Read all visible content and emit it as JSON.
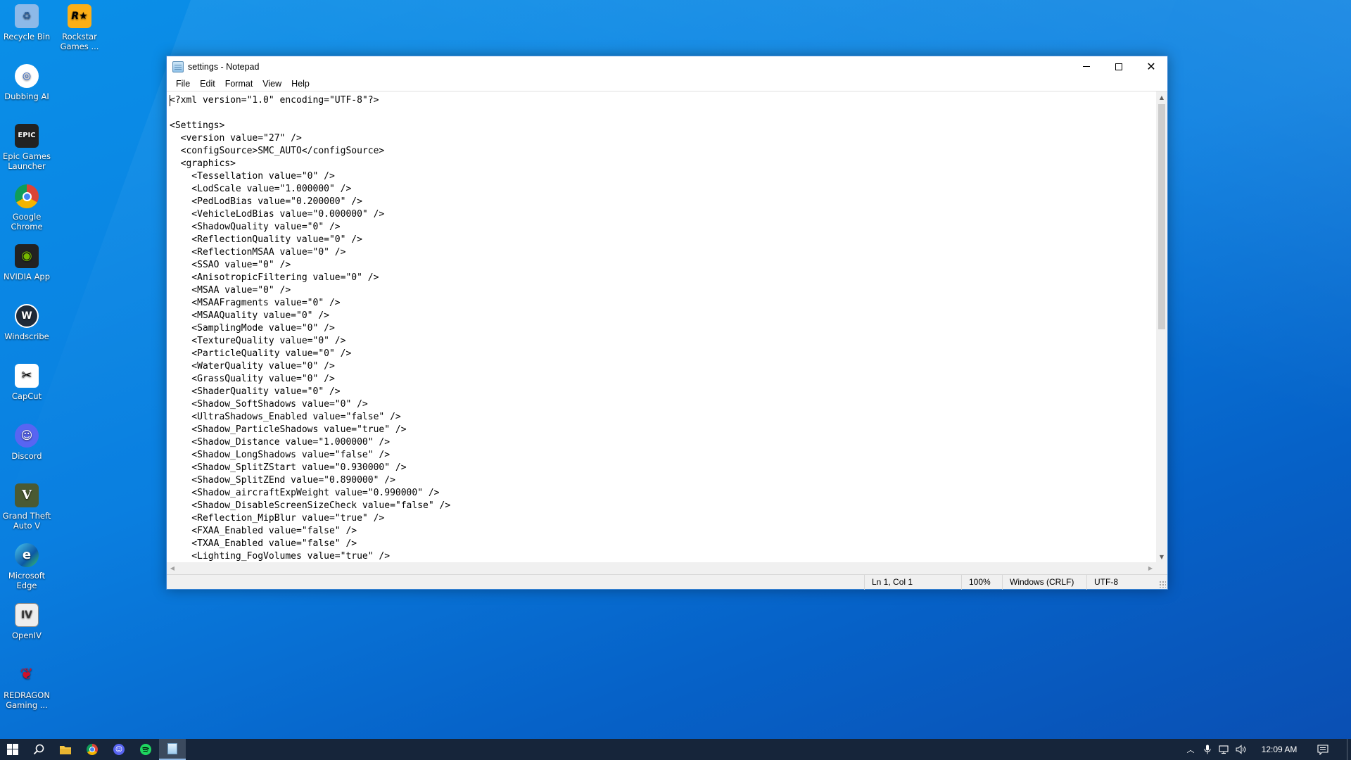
{
  "desktop": {
    "icons": [
      {
        "label": "Recycle Bin",
        "icon": "recycle-bin-icon",
        "color": "#6fa8dc",
        "glyph": "♻"
      },
      {
        "label": "Rockstar Games ...",
        "icon": "rockstar-games-icon",
        "color": "#fcaf17",
        "glyph": "R"
      },
      {
        "label": "Dubbing AI",
        "icon": "dubbing-ai-icon",
        "color": "#2a62c9",
        "glyph": "◎"
      },
      {
        "label": "Epic Games Launcher",
        "icon": "epic-games-icon",
        "color": "#202020",
        "glyph": "EPIC"
      },
      {
        "label": "Google Chrome",
        "icon": "chrome-icon",
        "color": "#e9e9e9",
        "glyph": "●"
      },
      {
        "label": "NVIDIA App",
        "icon": "nvidia-icon",
        "color": "#76b900",
        "glyph": "◉"
      },
      {
        "label": "Windscribe",
        "icon": "windscribe-icon",
        "color": "#1f2a38",
        "glyph": "W"
      },
      {
        "label": "CapCut",
        "icon": "capcut-icon",
        "color": "#111111",
        "glyph": "✂"
      },
      {
        "label": "Discord",
        "icon": "discord-icon",
        "color": "#5865f2",
        "glyph": "☺"
      },
      {
        "label": "Grand Theft Auto V",
        "icon": "gta-v-icon",
        "color": "#3b4a2a",
        "glyph": "V"
      },
      {
        "label": "Microsoft Edge",
        "icon": "edge-icon",
        "color": "#1c9be0",
        "glyph": "e"
      },
      {
        "label": "OpenIV",
        "icon": "openiv-icon",
        "color": "#e8e8e8",
        "glyph": "IV"
      },
      {
        "label": "REDRAGON Gaming ...",
        "icon": "redragon-icon",
        "color": "#c8102e",
        "glyph": "R"
      }
    ]
  },
  "window": {
    "title": "settings - Notepad",
    "menu": [
      "File",
      "Edit",
      "Format",
      "View",
      "Help"
    ],
    "content": "<?xml version=\"1.0\" encoding=\"UTF-8\"?>\n\n<Settings>\n  <version value=\"27\" />\n  <configSource>SMC_AUTO</configSource>\n  <graphics>\n    <Tessellation value=\"0\" />\n    <LodScale value=\"1.000000\" />\n    <PedLodBias value=\"0.200000\" />\n    <VehicleLodBias value=\"0.000000\" />\n    <ShadowQuality value=\"0\" />\n    <ReflectionQuality value=\"0\" />\n    <ReflectionMSAA value=\"0\" />\n    <SSAO value=\"0\" />\n    <AnisotropicFiltering value=\"0\" />\n    <MSAA value=\"0\" />\n    <MSAAFragments value=\"0\" />\n    <MSAAQuality value=\"0\" />\n    <SamplingMode value=\"0\" />\n    <TextureQuality value=\"0\" />\n    <ParticleQuality value=\"0\" />\n    <WaterQuality value=\"0\" />\n    <GrassQuality value=\"0\" />\n    <ShaderQuality value=\"0\" />\n    <Shadow_SoftShadows value=\"0\" />\n    <UltraShadows_Enabled value=\"false\" />\n    <Shadow_ParticleShadows value=\"true\" />\n    <Shadow_Distance value=\"1.000000\" />\n    <Shadow_LongShadows value=\"false\" />\n    <Shadow_SplitZStart value=\"0.930000\" />\n    <Shadow_SplitZEnd value=\"0.890000\" />\n    <Shadow_aircraftExpWeight value=\"0.990000\" />\n    <Shadow_DisableScreenSizeCheck value=\"false\" />\n    <Reflection_MipBlur value=\"true\" />\n    <FXAA_Enabled value=\"false\" />\n    <TXAA_Enabled value=\"false\" />\n    <Lighting_FogVolumes value=\"true\" />",
    "status": {
      "position": "Ln 1, Col 1",
      "zoom": "100%",
      "line_endings": "Windows (CRLF)",
      "encoding": "UTF-8"
    }
  },
  "taskbar": {
    "pinned": [
      {
        "name": "start-button",
        "icon": "windows-logo-icon"
      },
      {
        "name": "search-button",
        "icon": "search-icon"
      },
      {
        "name": "file-explorer-button",
        "icon": "folder-icon"
      },
      {
        "name": "chrome-taskbar-button",
        "icon": "chrome-icon"
      },
      {
        "name": "discord-taskbar-button",
        "icon": "discord-icon"
      },
      {
        "name": "spotify-taskbar-button",
        "icon": "spotify-icon"
      },
      {
        "name": "notepad-taskbar-button",
        "icon": "notepad-icon"
      }
    ],
    "clock": "12:09 AM"
  }
}
